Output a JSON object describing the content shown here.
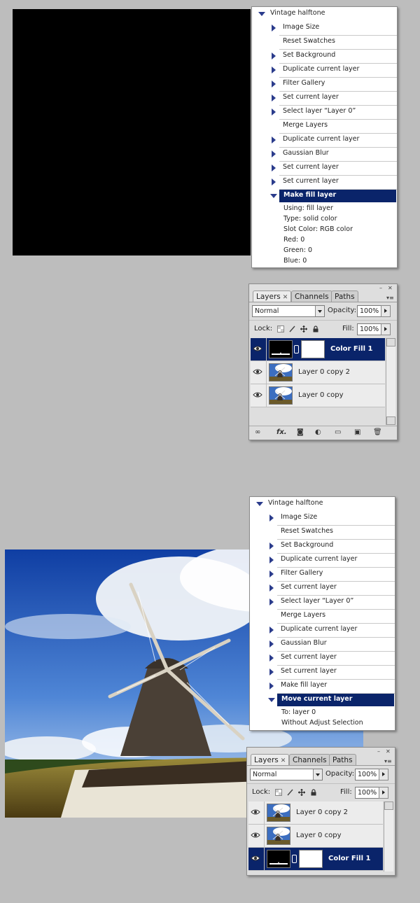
{
  "actions_top": {
    "set_name": "Vintage halftone",
    "items": [
      {
        "label": "Image Size",
        "triangle": true
      },
      {
        "label": "Reset Swatches",
        "triangle": false
      },
      {
        "label": "Set Background",
        "triangle": true
      },
      {
        "label": "Duplicate current layer",
        "triangle": true
      },
      {
        "label": "Filter Gallery",
        "triangle": true
      },
      {
        "label": "Set current layer",
        "triangle": true
      },
      {
        "label": "Select layer “Layer 0”",
        "triangle": true
      },
      {
        "label": "Merge Layers",
        "triangle": false
      },
      {
        "label": "Duplicate current layer",
        "triangle": true
      },
      {
        "label": "Gaussian Blur",
        "triangle": true
      },
      {
        "label": "Set current layer",
        "triangle": true
      },
      {
        "label": "Set current layer",
        "triangle": true
      }
    ],
    "selected": {
      "label": "Make fill layer"
    },
    "details": [
      "Using: fill layer",
      "Type: solid color",
      "Slot Color: RGB color",
      "Red: 0",
      "Green: 0",
      "Blue: 0"
    ]
  },
  "layers_top": {
    "tabs": [
      "Layers",
      "Channels",
      "Paths"
    ],
    "blend_mode": "Normal",
    "opacity_label": "Opacity:",
    "opacity_value": "100%",
    "lock_label": "Lock:",
    "fill_label": "Fill:",
    "fill_value": "100%",
    "rows": [
      {
        "name": "Color Fill 1",
        "type": "fill",
        "selected": true
      },
      {
        "name": "Layer 0 copy 2",
        "type": "photo",
        "selected": false
      },
      {
        "name": "Layer 0 copy",
        "type": "photo",
        "selected": false
      }
    ],
    "fx_label": "fx."
  },
  "actions_bottom": {
    "set_name": "Vintage halftone",
    "items": [
      {
        "label": "Image Size",
        "triangle": true
      },
      {
        "label": "Reset Swatches",
        "triangle": false
      },
      {
        "label": "Set Background",
        "triangle": true
      },
      {
        "label": "Duplicate current layer",
        "triangle": true
      },
      {
        "label": "Filter Gallery",
        "triangle": true
      },
      {
        "label": "Set current layer",
        "triangle": true
      },
      {
        "label": "Select layer “Layer 0”",
        "triangle": true
      },
      {
        "label": "Merge Layers",
        "triangle": false
      },
      {
        "label": "Duplicate current layer",
        "triangle": true
      },
      {
        "label": "Gaussian Blur",
        "triangle": true
      },
      {
        "label": "Set current layer",
        "triangle": true
      },
      {
        "label": "Set current layer",
        "triangle": true
      },
      {
        "label": "Make fill layer",
        "triangle": true
      }
    ],
    "selected": {
      "label": "Move current layer"
    },
    "details": [
      "To: layer 0",
      "Without Adjust Selection"
    ]
  },
  "layers_bottom": {
    "tabs": [
      "Layers",
      "Channels",
      "Paths"
    ],
    "blend_mode": "Normal",
    "opacity_label": "Opacity:",
    "opacity_value": "100%",
    "lock_label": "Lock:",
    "fill_label": "Fill:",
    "fill_value": "100%",
    "rows": [
      {
        "name": "Layer 0 copy 2",
        "type": "photo",
        "selected": false
      },
      {
        "name": "Layer 0 copy",
        "type": "photo",
        "selected": false
      },
      {
        "name": "Color Fill 1",
        "type": "fill",
        "selected": true
      }
    ]
  },
  "colors": {
    "selection": "#0a246a",
    "triangle": "#2b3c8c",
    "background": "#bdbdbd"
  }
}
